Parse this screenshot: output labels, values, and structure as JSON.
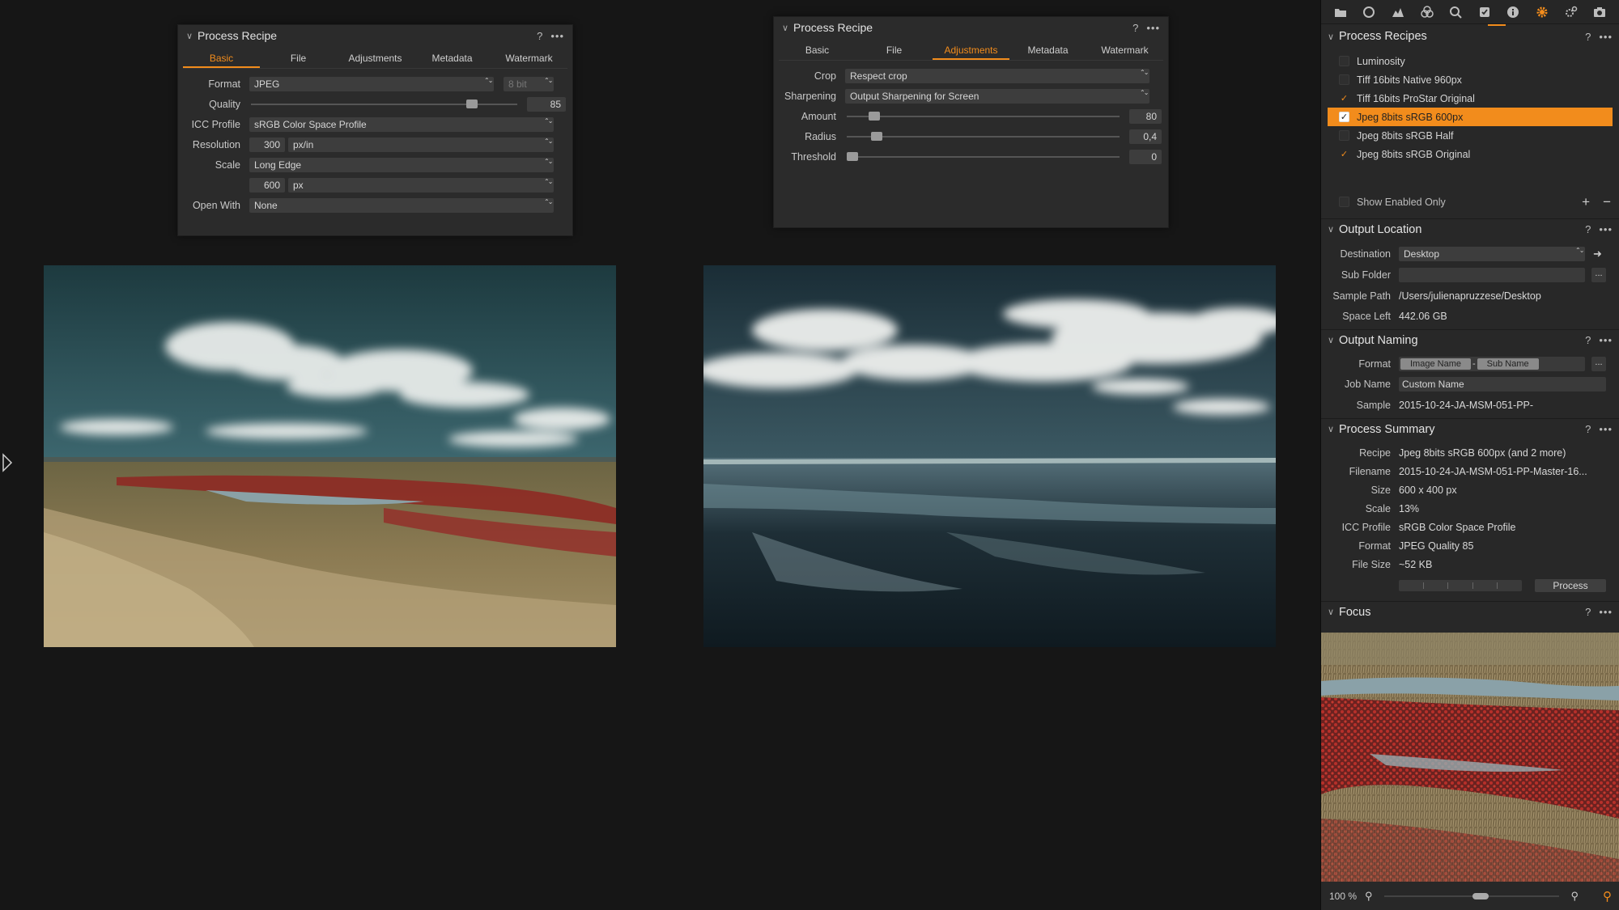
{
  "recipe_a": {
    "title": "Process Recipe",
    "tabs": [
      "Basic",
      "File",
      "Adjustments",
      "Metadata",
      "Watermark"
    ],
    "active_tab": "Basic",
    "format_label": "Format",
    "format_value": "JPEG",
    "bit_value": "8 bit",
    "quality_label": "Quality",
    "quality_value": "85",
    "quality_fraction": 0.83,
    "icc_label": "ICC Profile",
    "icc_value": "sRGB Color Space Profile",
    "resolution_label": "Resolution",
    "resolution_value": "300",
    "resolution_unit": "px/in",
    "scale_label": "Scale",
    "scale_value": "Long Edge",
    "scale_size": "600",
    "scale_unit": "px",
    "open_with_label": "Open With",
    "open_with_value": "None"
  },
  "recipe_b": {
    "title": "Process Recipe",
    "tabs": [
      "Basic",
      "File",
      "Adjustments",
      "Metadata",
      "Watermark"
    ],
    "active_tab": "Adjustments",
    "crop_label": "Crop",
    "crop_value": "Respect crop",
    "sharpening_label": "Sharpening",
    "sharpening_value": "Output Sharpening for Screen",
    "amount_label": "Amount",
    "amount_value": "80",
    "amount_fraction": 0.1,
    "radius_label": "Radius",
    "radius_value": "0,4",
    "radius_fraction": 0.11,
    "threshold_label": "Threshold",
    "threshold_value": "0",
    "threshold_fraction": 0.02
  },
  "sidebar": {
    "toolbar_icons": [
      "folder-icon",
      "lens-icon",
      "histogram-icon",
      "color-icon",
      "details-icon",
      "checklist-icon",
      "info-icon",
      "gear-icon",
      "settings-icon",
      "camera-icon"
    ],
    "process_recipes": {
      "title": "Process Recipes",
      "items": [
        {
          "label": "Luminosity",
          "checked": false,
          "selected": false
        },
        {
          "label": "Tiff 16bits Native 960px",
          "checked": false,
          "selected": false
        },
        {
          "label": "Tiff 16bits ProStar Original",
          "checked": true,
          "selected": false
        },
        {
          "label": "Jpeg 8bits sRGB 600px",
          "checked": true,
          "selected": true
        },
        {
          "label": "Jpeg 8bits sRGB Half",
          "checked": false,
          "selected": false
        },
        {
          "label": "Jpeg 8bits sRGB Original",
          "checked": true,
          "selected": false
        }
      ],
      "show_enabled_label": "Show Enabled Only"
    },
    "output_location": {
      "title": "Output Location",
      "destination_label": "Destination",
      "destination_value": "Desktop",
      "sub_folder_label": "Sub Folder",
      "sample_path_label": "Sample Path",
      "sample_path_value": "/Users/julienapruzzese/Desktop",
      "space_left_label": "Space Left",
      "space_left_value": "442.06 GB"
    },
    "output_naming": {
      "title": "Output Naming",
      "format_label": "Format",
      "token_1": "Image Name",
      "separator": "-",
      "token_2": "Sub Name",
      "job_name_label": "Job Name",
      "job_name_value": "Custom Name",
      "sample_label": "Sample",
      "sample_value": "2015-10-24-JA-MSM-051-PP-"
    },
    "process_summary": {
      "title": "Process Summary",
      "rows": [
        {
          "label": "Recipe",
          "value": "Jpeg 8bits sRGB 600px (and 2 more)"
        },
        {
          "label": "Filename",
          "value": "2015-10-24-JA-MSM-051-PP-Master-16..."
        },
        {
          "label": "Size",
          "value": "600 x 400 px"
        },
        {
          "label": "Scale",
          "value": "13%"
        },
        {
          "label": "ICC Profile",
          "value": "sRGB Color Space Profile"
        },
        {
          "label": "Format",
          "value": "JPEG Quality 85"
        },
        {
          "label": "File Size",
          "value": "~52 KB"
        }
      ],
      "process_button": "Process"
    },
    "focus": {
      "title": "Focus",
      "zoom": "100 %",
      "zoom_fraction": 0.55
    },
    "help_glyph": "?",
    "more_glyph": "•••",
    "ellipsis_button": "..."
  }
}
